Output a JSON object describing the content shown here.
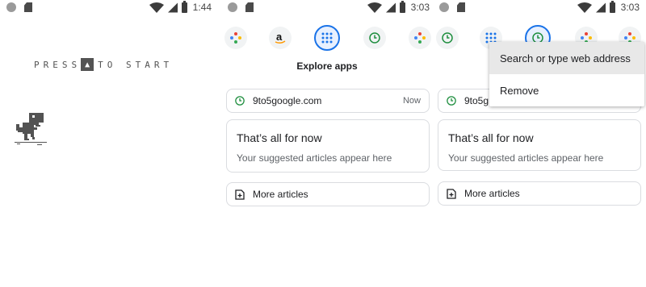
{
  "panel_a": {
    "time": "1:44",
    "press_label": "PRESS",
    "to_start_label": "TO START"
  },
  "panel_b": {
    "time": "3:03",
    "explore_label": "Explore apps",
    "history": {
      "title": "9to5google.com",
      "time_label": "Now"
    },
    "empty_card": {
      "title": "That’s all for now",
      "subtitle": "Your suggested articles appear here"
    },
    "more_label": "More articles"
  },
  "panel_c": {
    "time": "3:03",
    "history_title_visible": "9to5g",
    "empty_card": {
      "title": "That’s all for now",
      "subtitle": "Your suggested articles appear here"
    },
    "more_label": "More articles",
    "menu": {
      "items": [
        "Search or type web address",
        "Remove"
      ]
    }
  },
  "colors": {
    "accent": "#1a73e8",
    "text_primary": "#202124",
    "text_secondary": "#5f6368",
    "border": "#dadce0",
    "dino": "#535353"
  }
}
